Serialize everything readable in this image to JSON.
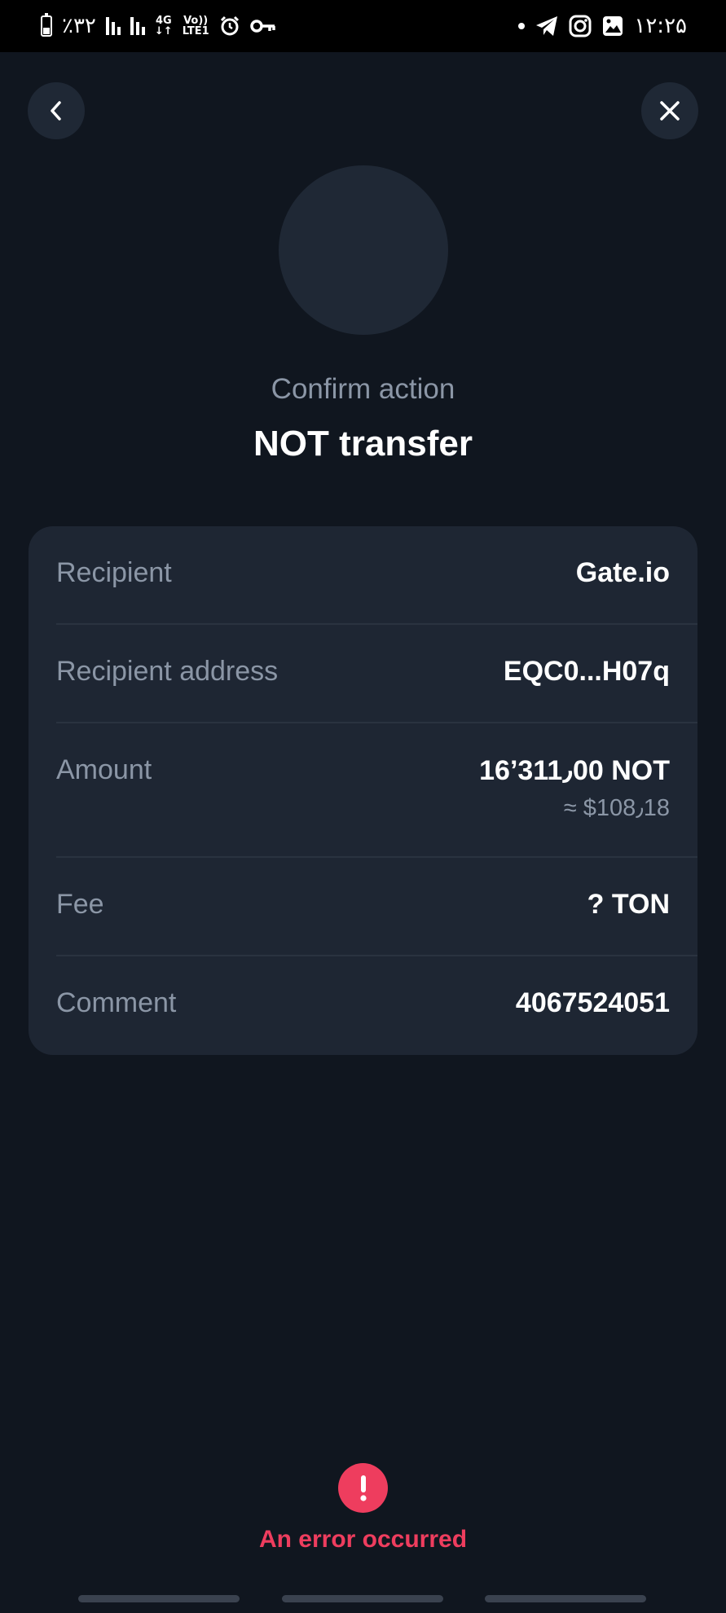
{
  "status_bar": {
    "battery_text": "٪۳۲",
    "network_top": "4G",
    "network_bottom": "↓↑",
    "volte_top": "Vo))",
    "volte_bottom": "LTE1",
    "time": "۱۲:۲۵"
  },
  "header": {
    "subtitle": "Confirm action",
    "title": "NOT transfer"
  },
  "details": {
    "recipient_label": "Recipient",
    "recipient_value": "Gate.io",
    "address_label": "Recipient address",
    "address_value": "EQC0...H07q",
    "amount_label": "Amount",
    "amount_value": "16’311٫00 NOT",
    "amount_fiat": "≈ $108٫18",
    "fee_label": "Fee",
    "fee_value": "? TON",
    "comment_label": "Comment",
    "comment_value": "4067524051"
  },
  "error": {
    "message": "An error occurred"
  },
  "colors": {
    "background": "#10161f",
    "card": "#1e2633",
    "muted_text": "#8b96a6",
    "error": "#ee3d5e"
  }
}
